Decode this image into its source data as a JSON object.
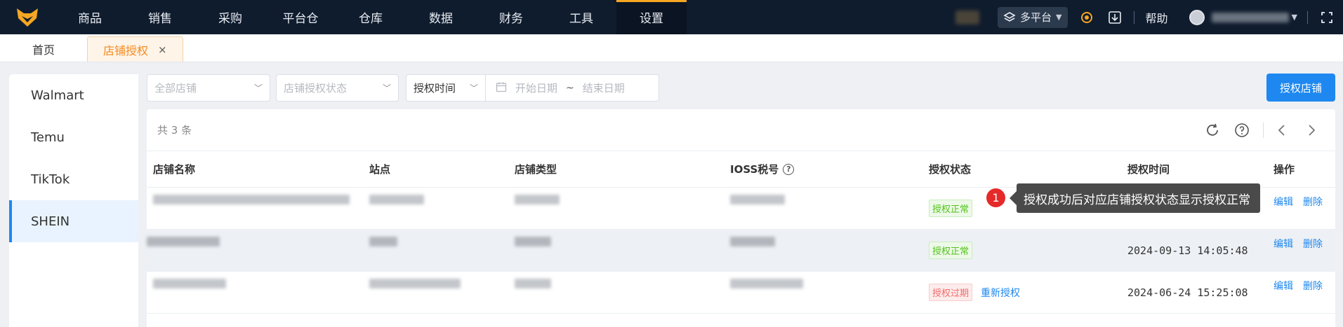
{
  "nav": {
    "items": [
      "商品",
      "销售",
      "采购",
      "平台仓",
      "仓库",
      "数据",
      "财务",
      "工具",
      "设置"
    ],
    "active": "设置",
    "platform": "多平台",
    "help": "帮助"
  },
  "tabs": {
    "home": "首页",
    "active": "店铺授权",
    "close": "×"
  },
  "sidebar": {
    "items": [
      "Walmart",
      "Temu",
      "TikTok",
      "SHEIN"
    ],
    "active": "SHEIN"
  },
  "filters": {
    "store_placeholder": "全部店铺",
    "status_placeholder": "店铺授权状态",
    "date_type": "授权时间",
    "start_placeholder": "开始日期",
    "range_sep": "~",
    "end_placeholder": "结束日期"
  },
  "primary_button": "授权店铺",
  "table": {
    "total": "共 3 条",
    "headers": {
      "name": "店铺名称",
      "site": "站点",
      "type": "店铺类型",
      "ioss": "IOSS税号",
      "status": "授权状态",
      "time": "授权时间",
      "ops": "操作"
    },
    "rows": [
      {
        "status": "授权正常",
        "status_kind": "ok",
        "reauth": "",
        "time": "",
        "edit": "编辑",
        "delete": "删除"
      },
      {
        "status": "授权正常",
        "status_kind": "ok",
        "reauth": "",
        "time": "2024-09-13 14:05:48",
        "edit": "编辑",
        "delete": "删除"
      },
      {
        "status": "授权过期",
        "status_kind": "bad",
        "reauth": "重新授权",
        "time": "2024-06-24 15:25:08",
        "edit": "编辑",
        "delete": "删除"
      }
    ]
  },
  "annotation": {
    "number": "1",
    "text": "授权成功后对应店铺授权状态显示授权正常"
  }
}
